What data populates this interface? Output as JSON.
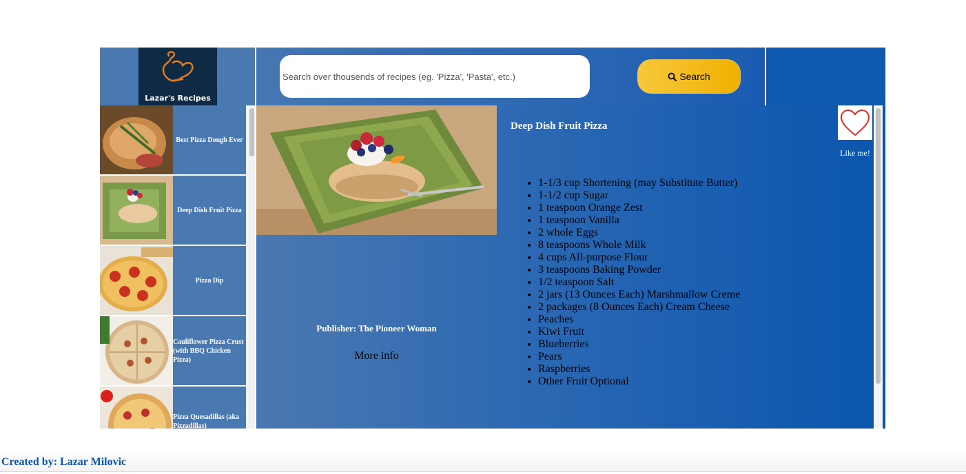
{
  "header": {
    "logo_text": "Lazar's Recipes",
    "search_placeholder": "Search over thousends of recipes (eg. 'Pizza', 'Pasta', etc.)",
    "search_button": "Search",
    "search_icon": "magnifier-icon"
  },
  "sidebar": {
    "results": [
      {
        "title": "Best Pizza Dough Ever"
      },
      {
        "title": "Deep Dish Fruit Pizza"
      },
      {
        "title": "Pizza Dip"
      },
      {
        "title": "Cauliflower Pizza Crust (with BBQ Chicken Pizza)"
      },
      {
        "title": "Pizza Quesadillas (aka Pizzadillas)"
      }
    ]
  },
  "recipe": {
    "title": "Deep Dish Fruit Pizza",
    "publisher": "Publisher: The Pioneer Woman",
    "more_info": "More info",
    "like_label": "Like me!",
    "ingredients": [
      "1-1/3 cup Shortening (may Substitute Butter)",
      "1-1/2 cup Sugar",
      "1 teaspoon Orange Zest",
      "1 teaspoon Vanilla",
      "2 whole Eggs",
      "8 teaspoons Whole Milk",
      "4 cups All-purpose Flour",
      "3 teaspoons Baking Powder",
      "1/2 teaspoon Salt",
      "2 jars (13 Ounces Each) Marshmallow Creme",
      "2 packages (8 Ounces Each) Cream Cheese",
      "Peaches",
      "Kiwi Fruit",
      "Blueberries",
      "Pears",
      "Raspberries",
      "Other Fruit Optional"
    ]
  },
  "footer": {
    "credit": "Created by: Lazar Milovic"
  },
  "colors": {
    "accent": "#0a55ae",
    "button": "#f0b000",
    "panel": "#4a78b0"
  }
}
